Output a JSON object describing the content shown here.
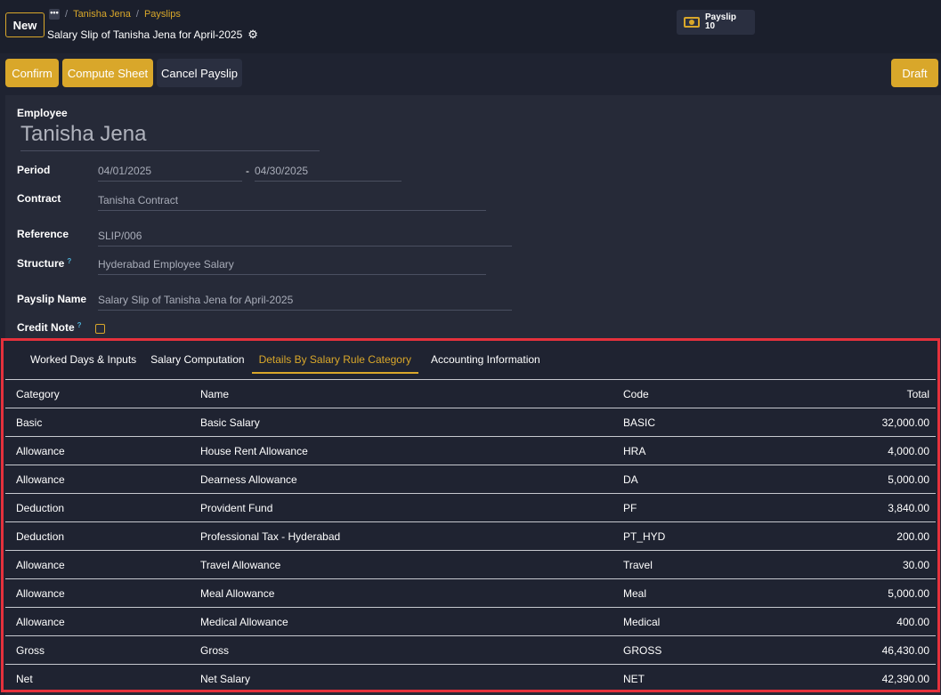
{
  "header": {
    "new_label": "New",
    "gear_glyph": "•••",
    "breadcrumb": [
      "Tanisha Jena",
      "Payslips"
    ],
    "breadcrumb_sep": "/",
    "record_title": "Salary Slip of Tanisha Jena for April-2025",
    "smart_button": {
      "label": "Payslip",
      "count": "10",
      "icon": "money-icon"
    }
  },
  "actions": {
    "confirm": "Confirm",
    "compute_sheet": "Compute Sheet",
    "cancel_payslip": "Cancel Payslip",
    "status": "Draft"
  },
  "form": {
    "employee_label": "Employee",
    "employee_value": "Tanisha Jena",
    "period_label": "Period",
    "period_from": "04/01/2025",
    "period_sep": "-",
    "period_to": "04/30/2025",
    "contract_label": "Contract",
    "contract_value": "Tanisha Contract",
    "reference_label": "Reference",
    "reference_value": "SLIP/006",
    "structure_label": "Structure",
    "structure_value": "Hyderabad Employee Salary",
    "payslip_name_label": "Payslip Name",
    "payslip_name_value": "Salary Slip of Tanisha Jena for April-2025",
    "credit_note_label": "Credit Note",
    "help_mark": "?"
  },
  "tabs": [
    {
      "label": "Worked Days & Inputs",
      "active": false
    },
    {
      "label": "Salary Computation",
      "active": false
    },
    {
      "label": "Details By Salary Rule Category",
      "active": true
    },
    {
      "label": "Accounting Information",
      "active": false
    }
  ],
  "table": {
    "headers": [
      "Category",
      "Name",
      "Code",
      "Total"
    ],
    "rows": [
      [
        "Basic",
        "Basic Salary",
        "BASIC",
        "32,000.00"
      ],
      [
        "Allowance",
        "House Rent Allowance",
        "HRA",
        "4,000.00"
      ],
      [
        "Allowance",
        "Dearness Allowance",
        "DA",
        "5,000.00"
      ],
      [
        "Deduction",
        "Provident Fund",
        "PF",
        "3,840.00"
      ],
      [
        "Deduction",
        "Professional Tax - Hyderabad",
        "PT_HYD",
        "200.00"
      ],
      [
        "Allowance",
        "Travel Allowance",
        "Travel",
        "30.00"
      ],
      [
        "Allowance",
        "Meal Allowance",
        "Meal",
        "5,000.00"
      ],
      [
        "Allowance",
        "Medical Allowance",
        "Medical",
        "400.00"
      ],
      [
        "Gross",
        "Gross",
        "GROSS",
        "46,430.00"
      ],
      [
        "Net",
        "Net Salary",
        "NET",
        "42,390.00"
      ]
    ]
  },
  "colors": {
    "accent": "#d9a72a",
    "highlight_border": "#e5313c",
    "background": "#1f2331"
  }
}
